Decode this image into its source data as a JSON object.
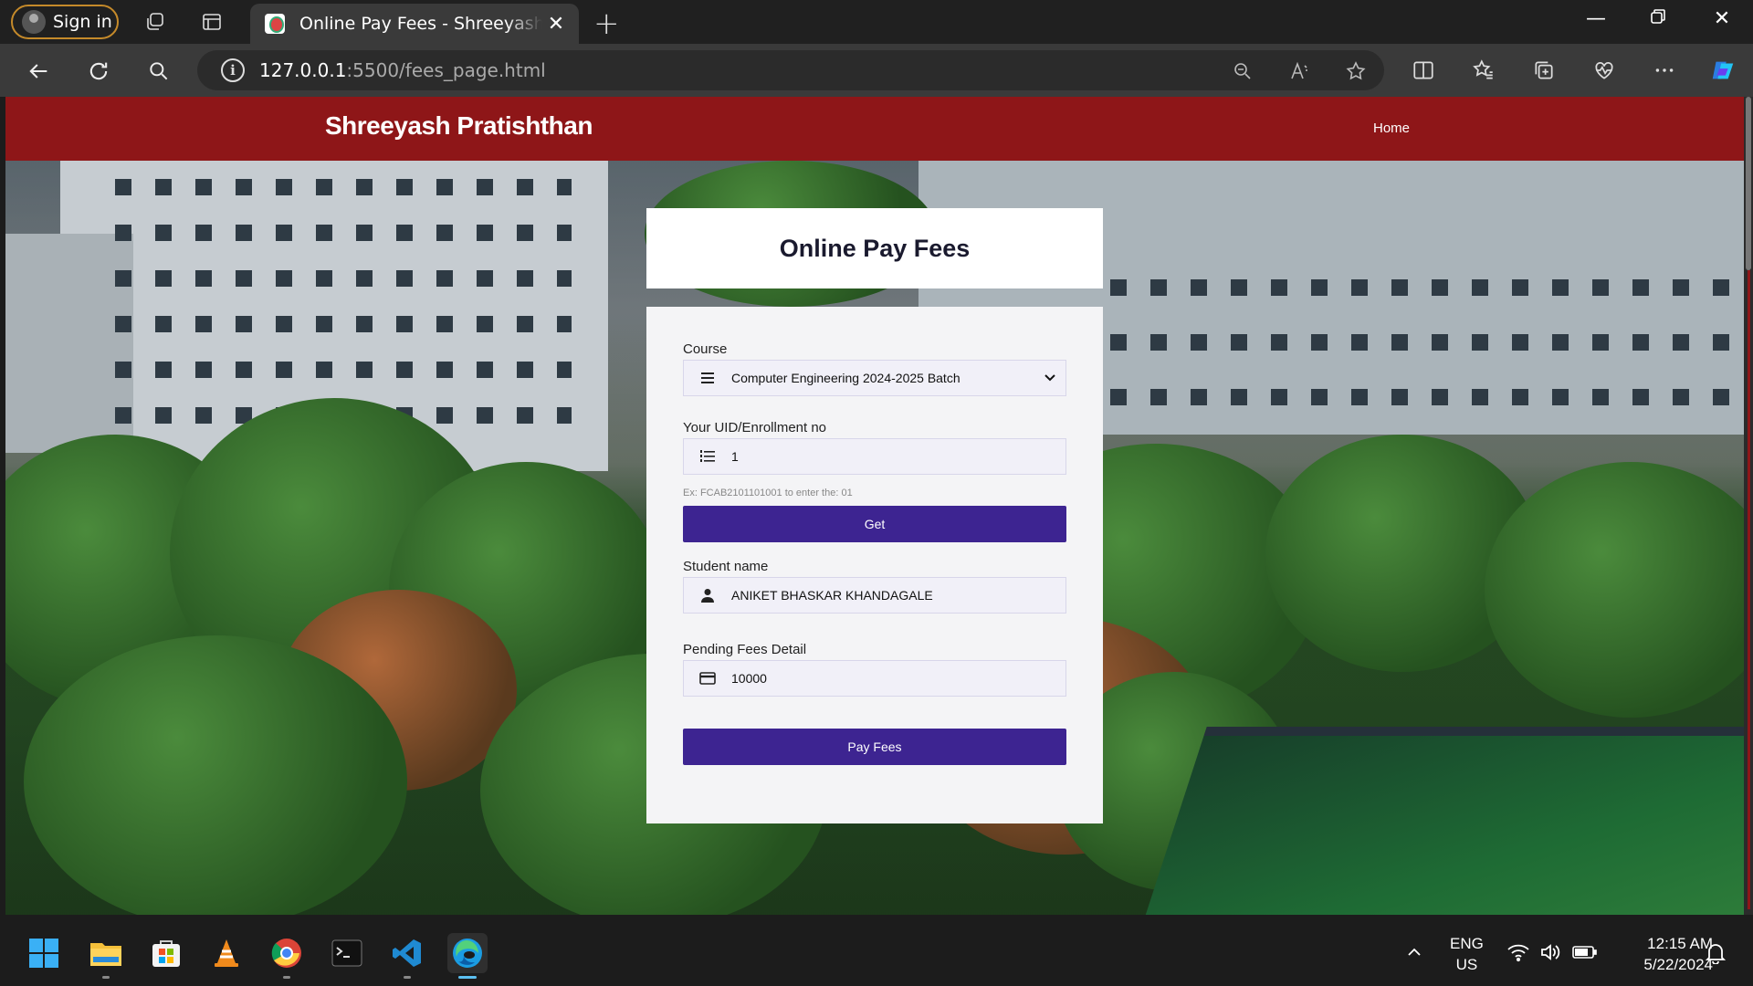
{
  "browser": {
    "profile_label": "Sign in",
    "tab_title": "Online Pay Fees - Shreeyash Pratishthan",
    "url_host": "127.0.0.1",
    "url_rest": ":5500/fees_page.html"
  },
  "site": {
    "brand": "Shreeyash Pratishthan",
    "nav_home": "Home",
    "accent_color": "#8e1618",
    "button_color": "#3d2491"
  },
  "form": {
    "title": "Online Pay Fees",
    "course_label": "Course",
    "course_value": "Computer Engineering 2024-2025 Batch",
    "uid_label": "Your UID/Enrollment no",
    "uid_value": "1",
    "uid_hint": "Ex: FCAB2101101001 to enter the: 01",
    "get_button": "Get",
    "student_label": "Student name",
    "student_value": "ANIKET BHASKAR KHANDAGALE",
    "fees_label": "Pending Fees Detail",
    "fees_value": "10000",
    "pay_button": "Pay Fees"
  },
  "taskbar": {
    "lang_line1": "ENG",
    "lang_line2": "US",
    "time": "12:15 AM",
    "date": "5/22/2024"
  }
}
